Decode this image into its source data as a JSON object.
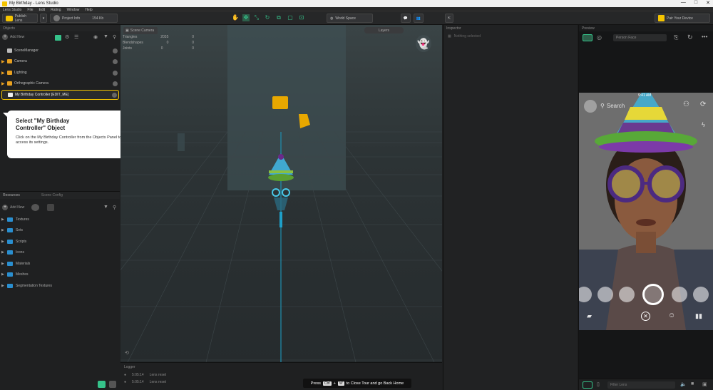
{
  "window": {
    "title": "My Birthday - Lens Studio",
    "minimize": "—",
    "maximize": "□",
    "close": "✕"
  },
  "menu": [
    "Lens Studio",
    "File",
    "Edit",
    "Rating",
    "Window",
    "Help"
  ],
  "toolbar": {
    "project_label": "Publish Lens",
    "project_info": "Project Info",
    "size": "154 Kb",
    "search_placeholder": "World Space",
    "pair_device": "Pair Your Device"
  },
  "objects_panel": {
    "title": "Objects",
    "add_new": "Add New",
    "items": [
      {
        "label": "SceneManager",
        "icon": "scene-icon"
      },
      {
        "label": "Camera",
        "icon": "camera-icon"
      },
      {
        "label": "Lighting",
        "icon": "light-icon"
      },
      {
        "label": "Orthographic Camera",
        "icon": "camera-icon"
      },
      {
        "label": "My Birthday Controller [EDIT_ME]",
        "icon": "script-icon"
      }
    ]
  },
  "tooltip": {
    "title": "Select \"My Birthday Controller\" Object",
    "body": "Click on the My Birthday Controller from the Objects Panel to access its settings."
  },
  "resources_panel": {
    "tabs": [
      "Resources",
      "Scene Config"
    ],
    "add_new": "Add New",
    "items": [
      "Textures",
      "Sets",
      "Scripts",
      "Icons",
      "Materials",
      "Meshes",
      "Segmentation Textures"
    ]
  },
  "viewport": {
    "camera_label": "Scene Camera",
    "layer_select": "Layers",
    "stats": [
      {
        "label": "Triangles",
        "a": "2035",
        "b": "0"
      },
      {
        "label": "Blendshapes",
        "a": "0",
        "b": "0"
      },
      {
        "label": "Joints",
        "a": "0",
        "b": "0"
      }
    ]
  },
  "inspector": {
    "title": "Inspector",
    "empty": "Nothing selected"
  },
  "preview": {
    "title": "Preview",
    "person_label": "Person Face",
    "search_label": "Search",
    "time": "9:41 AM",
    "filter_placeholder": "Filter Lens"
  },
  "logger": {
    "title": "Logger",
    "lines": [
      {
        "time": "5:05:14",
        "text": "Lens reset"
      },
      {
        "time": "5:05:14",
        "text": "Lens reset"
      }
    ]
  },
  "shortcut": {
    "press": "Press",
    "ctrl": "Ctrl",
    "plus": "+",
    "w": "W",
    "text": "to Close Tour and go Back Home"
  },
  "colors": {
    "accent": "#35c28a",
    "highlight": "#f5c400",
    "folder": "#2a8fd0"
  }
}
